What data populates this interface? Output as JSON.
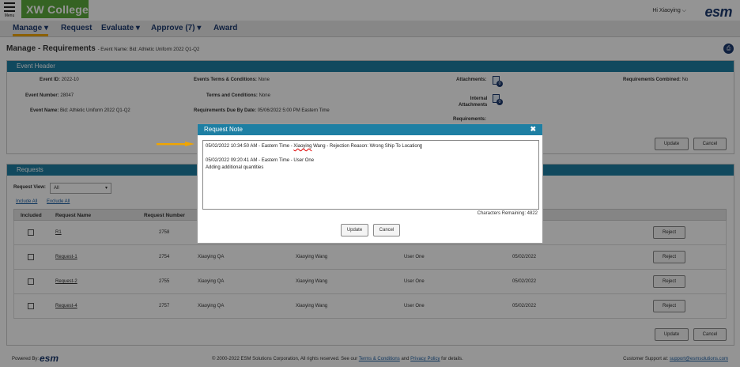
{
  "topbar": {
    "menu_label": "Menu",
    "logo_text": "XW College",
    "greeting": "Hi Xiaoying",
    "esm_logo": "esm"
  },
  "nav": [
    "Manage",
    "Request",
    "Evaluate",
    "Approve (7)",
    "Award"
  ],
  "page": {
    "title": "Manage - Requirements",
    "subtitle": "- Event Name: Bid: Athletic Uniform 2022 Q1-Q2"
  },
  "event_header": {
    "title": "Event Header",
    "event_id_label": "Event ID:",
    "event_id": "2022-10",
    "event_number_label": "Event Number:",
    "event_number": "28047",
    "event_name_label": "Event Name:",
    "event_name": "Bid: Athletic Uniform 2022 Q1-Q2",
    "terms_label": "Events Terms & Conditions:",
    "terms": "None",
    "terms2_label": "Terms and Conditions:",
    "terms2": "None",
    "due_label": "Requirements Due By Date:",
    "due": "05/06/2022 5:00 PM Eastern Time",
    "attachments_label": "Attachments:",
    "attachments_count": "0",
    "internal_label1": "Internal",
    "internal_label2": "Attachments",
    "internal_count": "0",
    "requirements_label": "Requirements:",
    "combined_label": "Requirements Combined:",
    "combined": "No",
    "update": "Update",
    "cancel": "Cancel"
  },
  "requests": {
    "title": "Requests",
    "view_label": "Request View:",
    "view_value": "All",
    "include_all": "Include All",
    "exclude_all": "Exclude All",
    "columns": [
      "Included",
      "Request Name",
      "Request Number"
    ],
    "rows": [
      {
        "name": "R1",
        "number": "2758",
        "col3": "",
        "col4": "",
        "col5": "",
        "col6": ""
      },
      {
        "name": "Request-1",
        "number": "2754",
        "col3": "Xiaoying QA",
        "col4": "Xiaoying Wang",
        "col5": "User One",
        "col6": "05/02/2022"
      },
      {
        "name": "Request-2",
        "number": "2755",
        "col3": "Xiaoying QA",
        "col4": "Xiaoying Wang",
        "col5": "User One",
        "col6": "05/02/2022"
      },
      {
        "name": "Request-4",
        "number": "2757",
        "col3": "Xiaoying QA",
        "col4": "Xiaoying Wang",
        "col5": "User One",
        "col6": "05/02/2022"
      }
    ],
    "reject": "Reject",
    "update": "Update",
    "cancel": "Cancel"
  },
  "modal": {
    "title": "Request Note",
    "close": "✖",
    "line1_pre": "05/02/2022 10:34:50 AM - Eastern Time - ",
    "line1_name": "Xiaoying",
    "line1_post": " Wang - Rejection Reason: Wrong Ship To Location",
    "line2": "05/02/2022 09:20:41 AM - Eastern Time - User One",
    "line3": "Adding additional quantities",
    "remaining": "Characters Remaining: 4822",
    "update": "Update",
    "cancel": "Cancel"
  },
  "footer": {
    "powered": "Powered By:",
    "powered_logo": "esm",
    "copy_pre": "© 2000-2022 ESM Solutions Corporation, All rights reserved. See our ",
    "terms": "Terms & Conditions",
    "and": " and ",
    "privacy": "Privacy Policy",
    "copy_post": " for details.",
    "support_label": "Customer Support at: ",
    "support_email": "support@esmsolutions.com"
  }
}
